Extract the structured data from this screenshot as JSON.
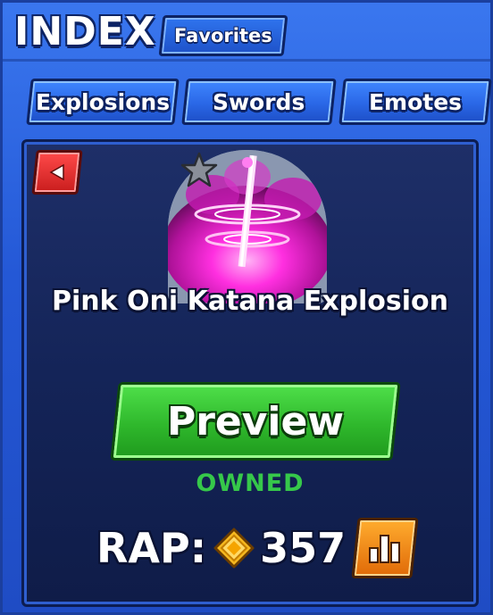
{
  "header": {
    "title": "INDEX",
    "favorites_label": "Favorites"
  },
  "tabs": [
    {
      "label": "Explosions"
    },
    {
      "label": "Swords"
    },
    {
      "label": "Emotes"
    }
  ],
  "item": {
    "name": "Pink Oni Katana Explosion",
    "art_icon": "pink-katana-explosion-icon",
    "favorite_icon": "star-icon",
    "preview_label": "Preview",
    "status": "OWNED"
  },
  "rap": {
    "label": "RAP:",
    "value": "357",
    "currency_icon": "gem-coin-icon",
    "stats_icon": "bar-chart-icon"
  },
  "colors": {
    "accent_blue": "#2a62d8",
    "panel_navy": "#142458",
    "preview_green": "#2fb82c",
    "owned_green": "#36c84a",
    "back_red": "#e02a2a",
    "stats_orange": "#f08a1a",
    "coin_gold": "#f5b820",
    "explosion_pink": "#ff2fe0"
  }
}
